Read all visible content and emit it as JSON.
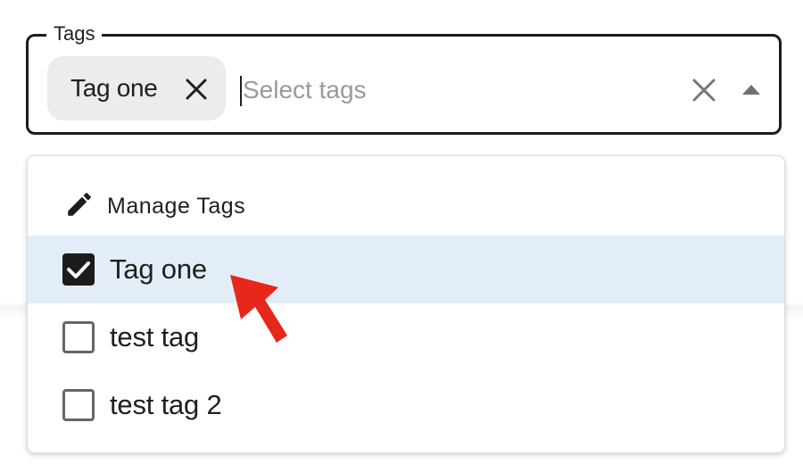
{
  "field": {
    "label": "Tags",
    "placeholder": "Select tags",
    "value": "",
    "chips": [
      {
        "label": "Tag one",
        "remove_icon": "close-icon"
      }
    ],
    "clear_icon": "close-icon",
    "toggle_icon": "caret-up-icon"
  },
  "dropdown": {
    "manage": {
      "label": "Manage Tags",
      "icon": "pencil-icon"
    },
    "options": [
      {
        "label": "Tag one",
        "checked": true,
        "highlighted": true
      },
      {
        "label": "test tag",
        "checked": false,
        "highlighted": false
      },
      {
        "label": "test tag 2",
        "checked": false,
        "highlighted": false
      }
    ]
  },
  "annotation": {
    "icon": "arrow-pointer-icon",
    "color": "#e8271b"
  },
  "colors": {
    "highlight": "#e3edf7",
    "chip_bg": "#ececec",
    "border": "#1c1c1c",
    "placeholder": "#9a9a9a"
  }
}
